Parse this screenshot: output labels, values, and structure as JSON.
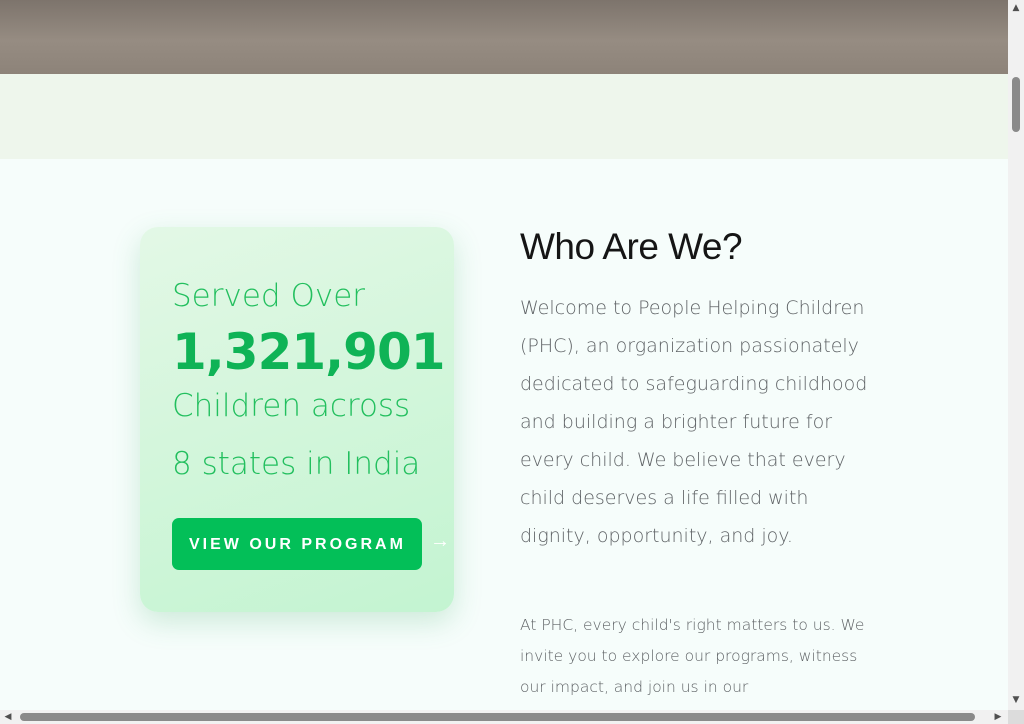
{
  "stats_card": {
    "served_label": "Served Over",
    "children_count": "1,321,901",
    "children_label": "Children across",
    "states_label": "8 states in India",
    "cta_label": "VIEW OUR PROGRAM",
    "cta_arrow": "→"
  },
  "about": {
    "title": "Who Are We?",
    "intro": "Welcome to People Helping Children (PHC), an organization passionately dedicated to safeguarding childhood and building a brighter future for every child. We believe that every child deserves a life filled with dignity, opportunity, and joy.",
    "invite": "At PHC, every child's right matters to us. We invite you to explore our programs, witness our impact, and join us in our"
  },
  "colors": {
    "accent_green": "#03bf58",
    "stat_text": "#22bf5e",
    "band_green": "#eef6ec"
  },
  "icons": {
    "cta_arrow": "arrow-right-icon",
    "scroll_up": "scroll-up-arrow-icon",
    "scroll_down": "scroll-down-arrow-icon",
    "scroll_left": "scroll-left-arrow-icon",
    "scroll_right": "scroll-right-arrow-icon"
  },
  "scroll": {
    "vertical_position": 0.11,
    "horizontal_position": 0.0
  }
}
